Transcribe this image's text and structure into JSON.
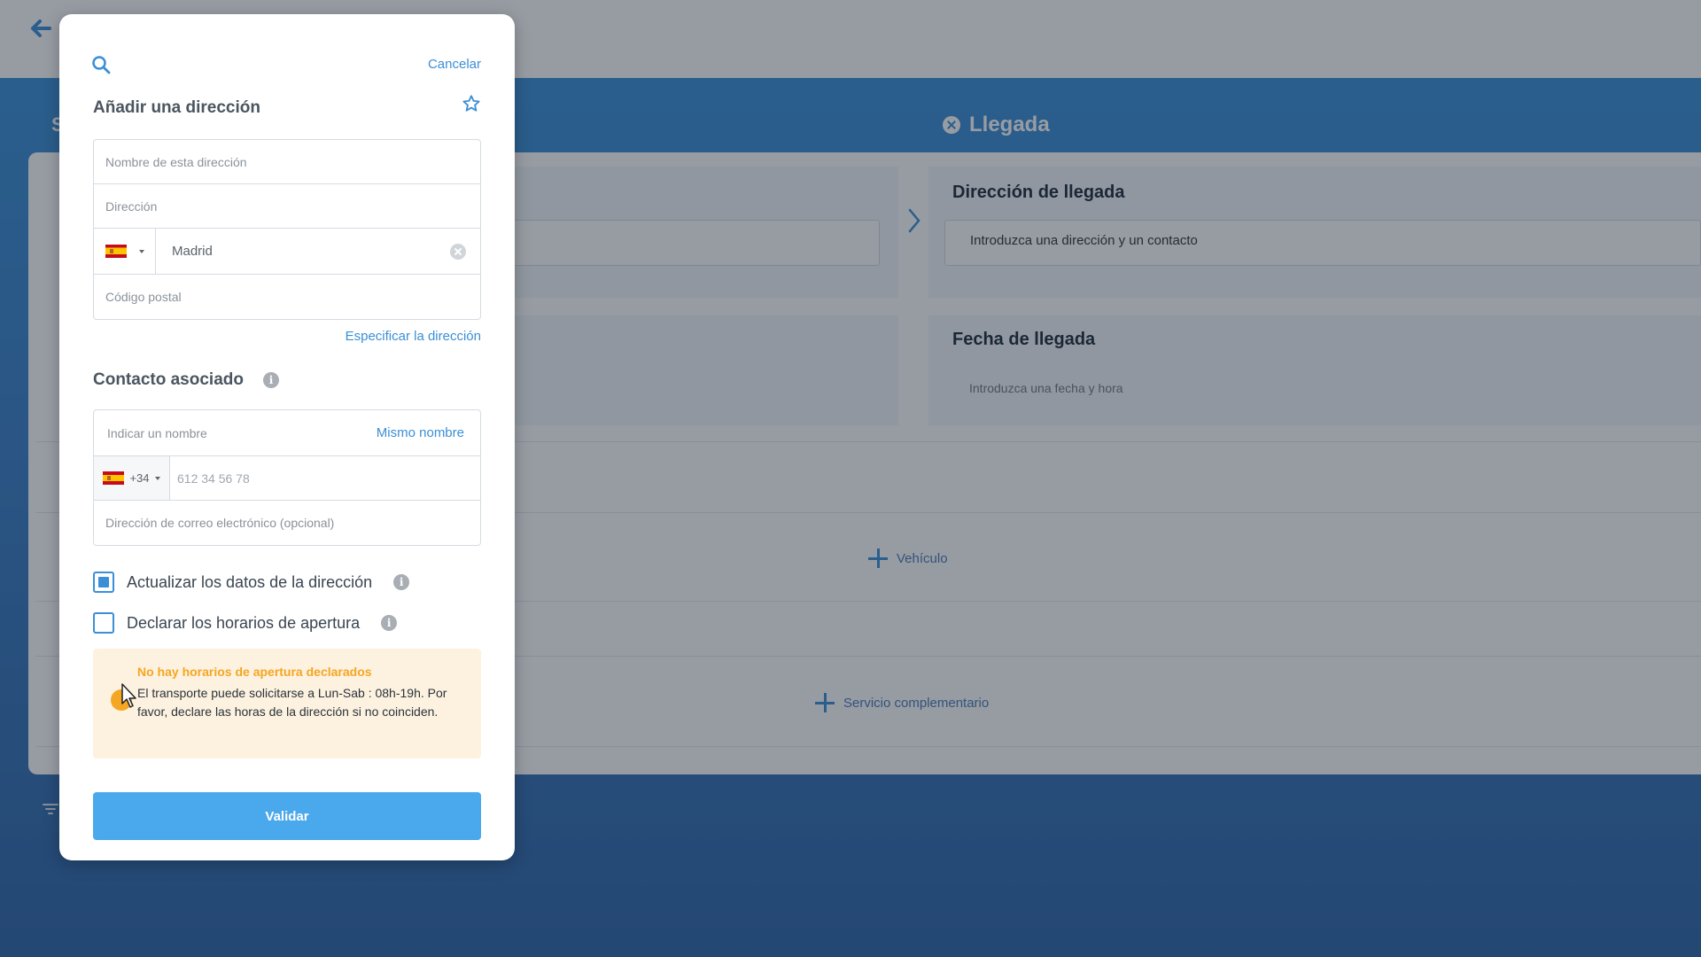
{
  "background": {
    "left_step_label": "S",
    "step_tab_label": "Llegada",
    "arrival_address": {
      "title": "Dirección de llegada",
      "placeholder": "Introduzca una dirección y un contacto"
    },
    "arrival_date": {
      "title": "Fecha de llegada",
      "placeholder": "Introduzca una fecha y hora"
    },
    "add_vehicle_label": "Vehículo",
    "add_service_label": "Servicio complementario"
  },
  "modal": {
    "cancel_label": "Cancelar",
    "title": "Añadir una dirección",
    "address_fields": {
      "name_placeholder": "Nombre de esta dirección",
      "address_placeholder": "Dirección",
      "city_value": "Madrid",
      "postal_placeholder": "Código postal"
    },
    "specify_link": "Especificar la dirección",
    "contact_section_title": "Contacto asociado",
    "contact_fields": {
      "name_placeholder": "Indicar un nombre",
      "same_name_label": "Mismo nombre",
      "phone_prefix": "+34",
      "phone_placeholder": "612 34 56 78",
      "email_placeholder": "Dirección de correo electrónico (opcional)"
    },
    "checkboxes": [
      {
        "label": "Actualizar los datos de la dirección",
        "checked": true
      },
      {
        "label": "Declarar los horarios de apertura",
        "checked": false
      }
    ],
    "warning": {
      "title": "No hay horarios de apertura declarados",
      "text": "El transporte puede solicitarse a Lun-Sab : 08h-19h. Por favor, declare las horas de la dirección si no coinciden."
    },
    "validate_label": "Validar"
  },
  "icons": {
    "search": "search-icon",
    "star": "star-icon",
    "info": "info-icon",
    "clear": "clear-icon",
    "flag": "spain-flag-icon",
    "warning": "warning-icon",
    "back": "back-arrow-icon"
  },
  "colors": {
    "accent": "#3a8fd6",
    "button": "#4aa8ec",
    "warning_bg": "#fdf2e0",
    "warning_text": "#f5a623"
  }
}
